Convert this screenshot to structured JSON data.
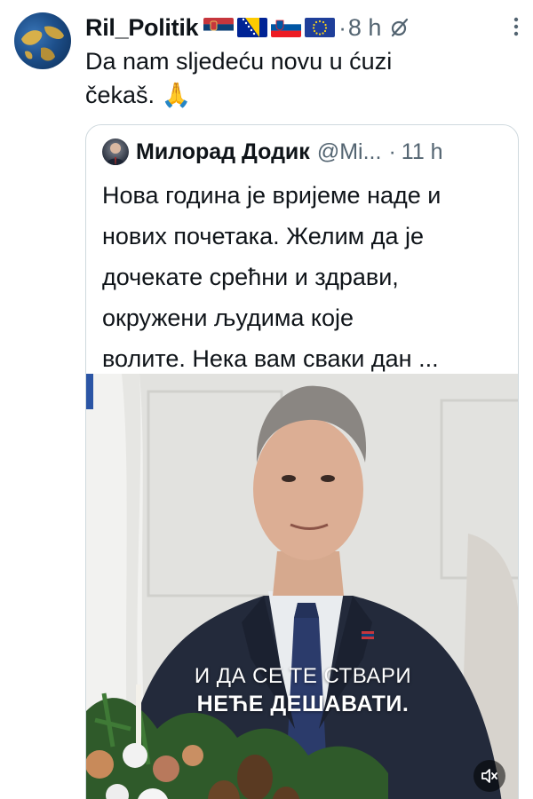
{
  "tweet": {
    "display_name": "Ril_Politik",
    "flags": [
      "serbia-flag",
      "bosnia-flag",
      "slovenia-flag",
      "eu-flag"
    ],
    "separator": "·",
    "time": "8 h",
    "text_line1": "Da nam sljedeću novu u ćuzi",
    "text_line2": "čekaš. 🙏"
  },
  "quoted": {
    "display_name": "Милорад Додик",
    "handle": "@Mi...",
    "separator": "·",
    "time": "11 h",
    "lines": [
      "Нова година је вријеме наде и",
      "нових почетака. Желим да је",
      "дочекате срећни и здрави,",
      "окружени људима које",
      "волите. Нека вам сваки дан ..."
    ],
    "video": {
      "subtitle_line1": "И ДА СЕ ТЕ СТВАРИ",
      "subtitle_line2": "НЕЋЕ ДЕШАВАТИ."
    }
  },
  "colors": {
    "text": "#0f1419",
    "muted": "#536471",
    "border": "#cfd9de"
  }
}
